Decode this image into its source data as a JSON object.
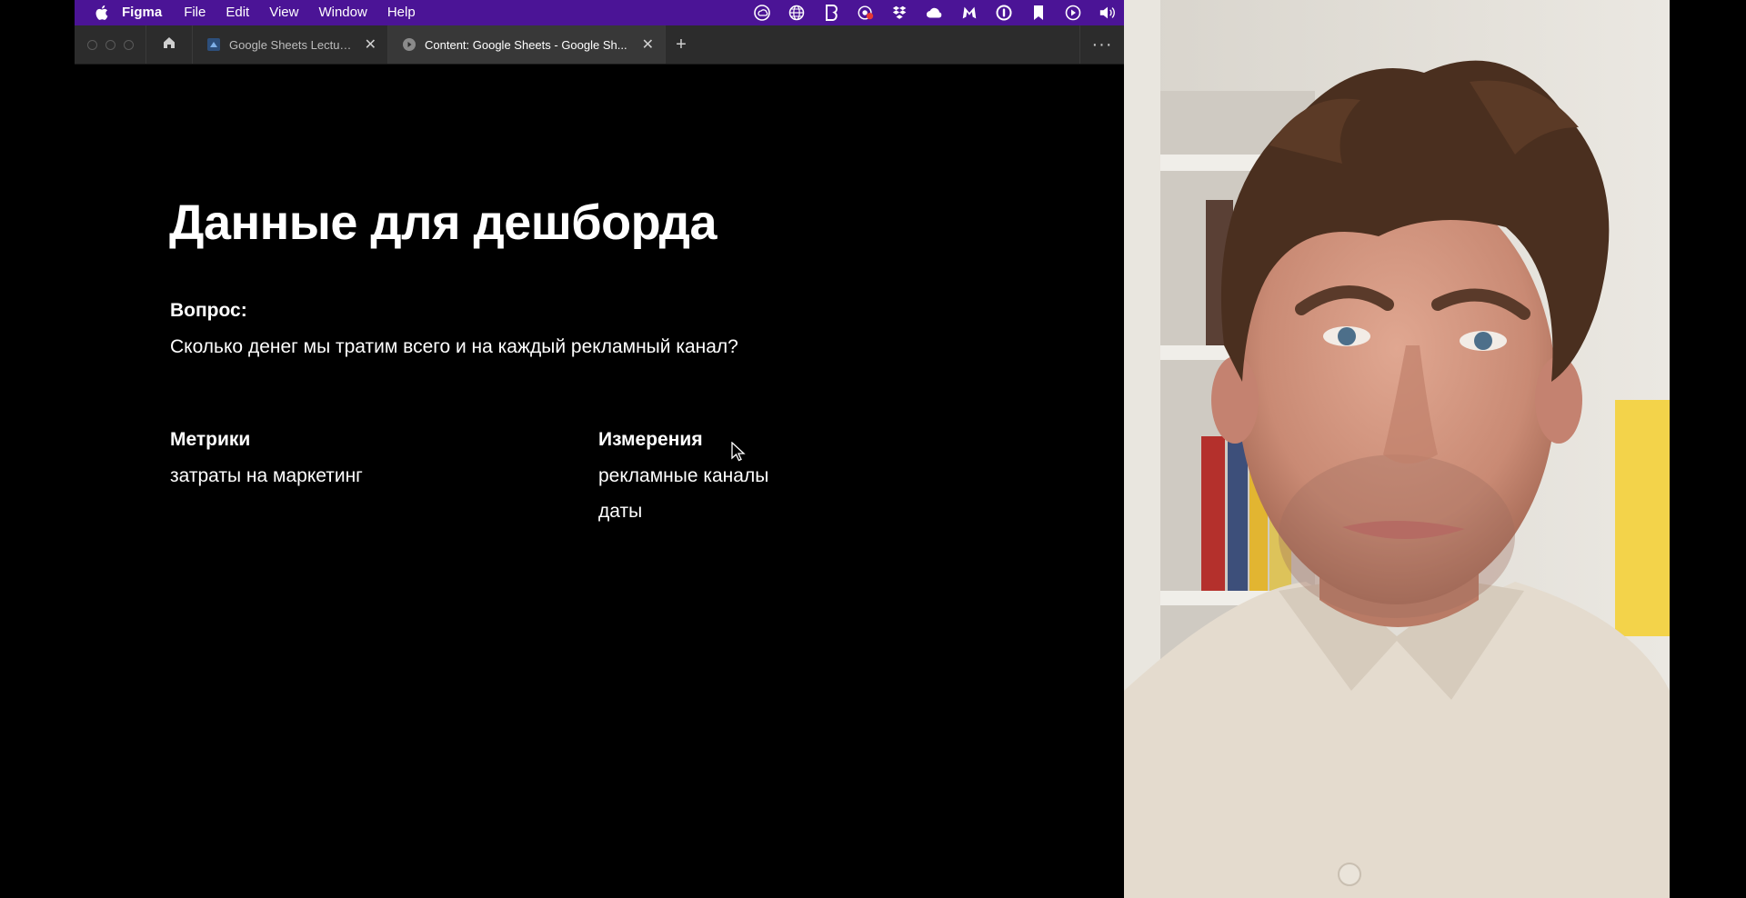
{
  "menubar": {
    "app_name": "Figma",
    "menus": [
      "File",
      "Edit",
      "View",
      "Window",
      "Help"
    ],
    "status_icons": [
      "creative-cloud-icon",
      "globe-icon",
      "bear-icon",
      "recording-icon",
      "dropbox-icon",
      "cloud-icon",
      "malwarebytes-icon",
      "1password-icon",
      "bookmark-icon",
      "play-icon",
      "volume-icon"
    ],
    "bar_color": "#4b1496"
  },
  "tabs": [
    {
      "label": "Google Sheets Lectures",
      "icon": "figma-file-icon",
      "active": false
    },
    {
      "label": "Content: Google Sheets - Google Sh...",
      "icon": "play-icon",
      "active": true
    }
  ],
  "slide": {
    "title": "Данные для дешборда",
    "question_label": "Вопрос:",
    "question_text": "Сколько денег мы тратим всего и на каждый рекламный канал?",
    "metrics_heading": "Метрики",
    "metrics_items": [
      "затраты на маркетинг"
    ],
    "dimensions_heading": "Измерения",
    "dimensions_items": [
      "рекламные каналы",
      "даты"
    ]
  }
}
